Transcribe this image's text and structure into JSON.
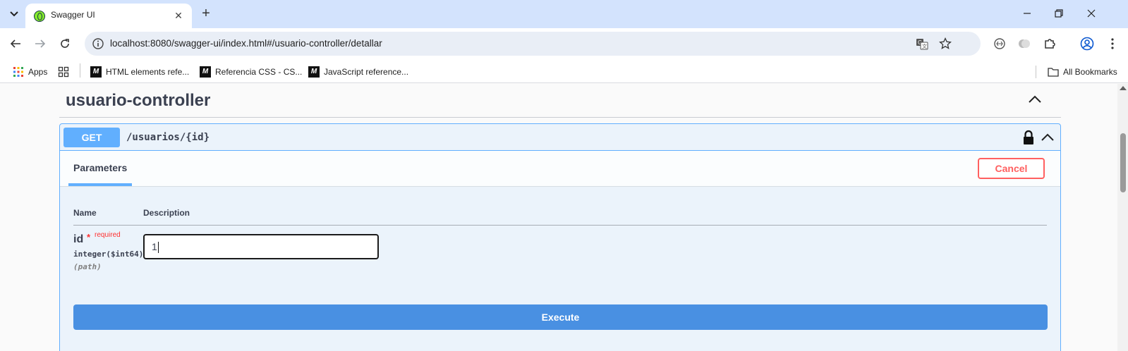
{
  "browser": {
    "tab_title": "Swagger UI",
    "url": "localhost:8080/swagger-ui/index.html#/usuario-controller/detallar",
    "bookmarks": {
      "apps_label": "Apps",
      "items": [
        {
          "label": "HTML elements refe..."
        },
        {
          "label": "Referencia CSS - CS..."
        },
        {
          "label": "JavaScript reference..."
        }
      ],
      "all_bookmarks": "All Bookmarks"
    }
  },
  "swagger": {
    "tag_title": "usuario-controller",
    "operation": {
      "method": "GET",
      "path": "/usuarios/{id}",
      "color": "#61affe"
    },
    "parameters_tab": "Parameters",
    "cancel_label": "Cancel",
    "table_headers": {
      "name": "Name",
      "description": "Description"
    },
    "param": {
      "name": "id",
      "required_star": "*",
      "required_label": "required",
      "type": "integer($int64)",
      "location": "(path)",
      "value": "1"
    },
    "execute_label": "Execute"
  }
}
